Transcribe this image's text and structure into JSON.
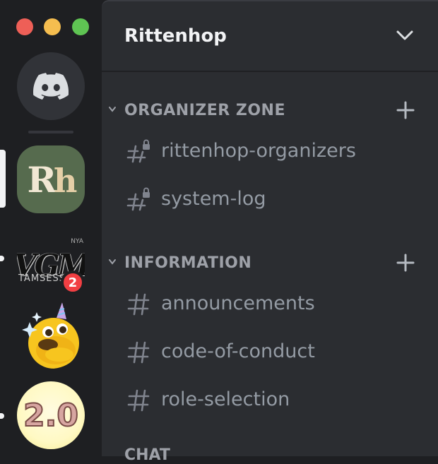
{
  "window": {
    "controls": [
      "close",
      "minimize",
      "zoom"
    ]
  },
  "servers": [
    {
      "name": "Direct Messages",
      "icon": "discord-logo-icon"
    },
    {
      "name": "Rittenhop",
      "initials_main": "R",
      "initials_sub": "h",
      "selected": true
    },
    {
      "name": "VGM server",
      "logo_text": "VGM",
      "sub_text": "TAMSESS",
      "corner_text": "NYA",
      "mentions": "2",
      "unread": true
    },
    {
      "name": "Emoji server",
      "icon": "unicorn-face-emoji-icon"
    },
    {
      "name": "2.0 server",
      "logo_text": "2.0",
      "unread": true
    }
  ],
  "header": {
    "server_name": "Rittenhop"
  },
  "categories": [
    {
      "label": "ORGANIZER ZONE",
      "channels": [
        {
          "name": "rittenhop-organizers",
          "locked": true
        },
        {
          "name": "system-log",
          "locked": true
        }
      ]
    },
    {
      "label": "INFORMATION",
      "channels": [
        {
          "name": "announcements",
          "locked": false
        },
        {
          "name": "code-of-conduct",
          "locked": false
        },
        {
          "name": "role-selection",
          "locked": false
        }
      ]
    },
    {
      "label": "CHAT",
      "channels": []
    }
  ],
  "colors": {
    "rail_bg": "#1e1f22",
    "panel_bg": "#2b2d31",
    "badge": "#f23f43",
    "channel_text": "#949ba4",
    "category_text": "#9ea1a8"
  }
}
